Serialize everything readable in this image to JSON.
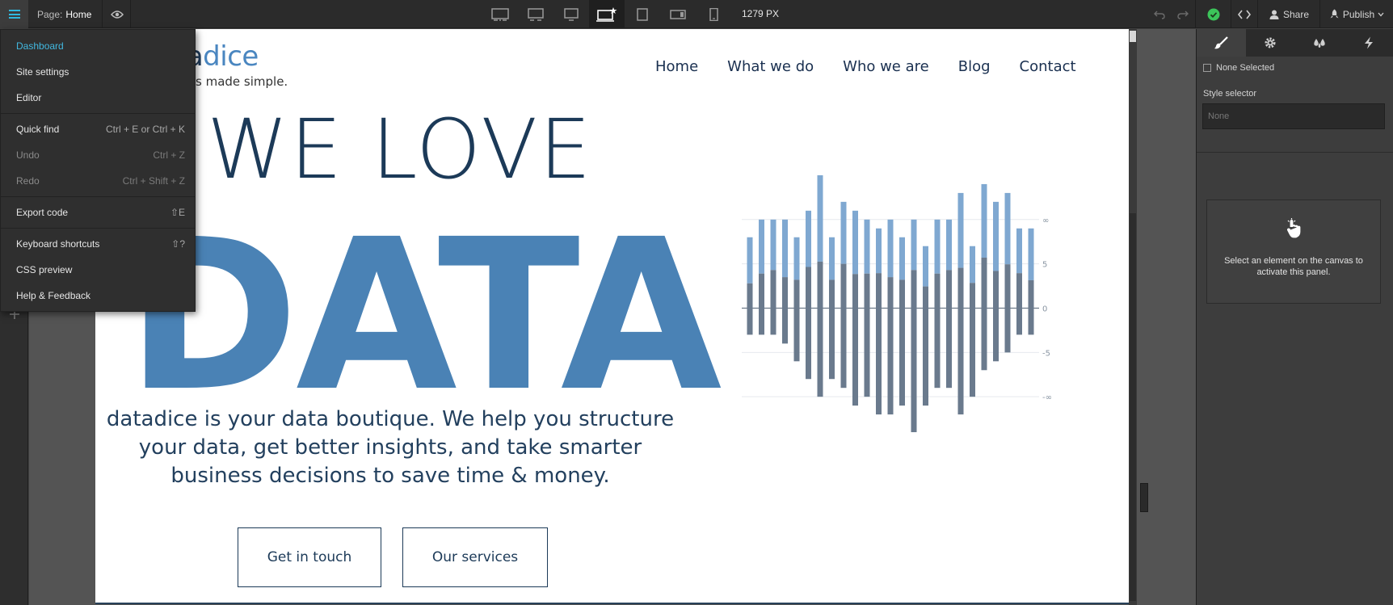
{
  "topbar": {
    "page_label": "Page:",
    "page_name": "Home",
    "width_readout": "1279 PX",
    "share_label": "Share",
    "publish_label": "Publish"
  },
  "menu": {
    "items": [
      {
        "label": "Dashboard",
        "shortcut": ""
      },
      {
        "label": "Site settings",
        "shortcut": ""
      },
      {
        "label": "Editor",
        "shortcut": ""
      },
      {
        "label": "Quick find",
        "shortcut": "Ctrl + E or Ctrl + K"
      },
      {
        "label": "Undo",
        "shortcut": "Ctrl + Z"
      },
      {
        "label": "Redo",
        "shortcut": "Ctrl + Shift + Z"
      },
      {
        "label": "Export code",
        "shortcut": "⇧E"
      },
      {
        "label": "Keyboard shortcuts",
        "shortcut": "⇧?"
      },
      {
        "label": "CSS preview",
        "shortcut": ""
      },
      {
        "label": "Help & Feedback",
        "shortcut": ""
      }
    ]
  },
  "site": {
    "logo_visible": "tadice",
    "logo_tagline_visible": "s made simple.",
    "nav": [
      "Home",
      "What we do",
      "Who we are",
      "Blog",
      "Contact"
    ],
    "hero_line1": "WE LOVE",
    "hero_line2": "DATA",
    "hero_paragraph": "datadice is your data boutique. We help you structure your data, get better insights, and take smarter business decisions to save time & money.",
    "cta_primary": "Get in touch",
    "cta_secondary": "Our services"
  },
  "panel": {
    "none_selected": "None Selected",
    "style_selector_label": "Style selector",
    "style_selector_placeholder": "None",
    "empty_message": "Select an element on the canvas to activate this panel."
  },
  "colors": {
    "accent": "#42b8e0",
    "brand_dark": "#1c3a58",
    "brand_blue": "#4a82b5",
    "success": "#3cc45a"
  },
  "chart_data": {
    "type": "bar",
    "y_tick_labels": [
      "∞",
      "5",
      "0",
      "-5",
      "-∞"
    ],
    "series": [
      {
        "values": [
          8,
          10,
          10,
          10,
          8,
          11,
          15,
          8,
          12,
          11,
          10,
          9,
          10,
          8,
          10,
          7,
          10,
          10,
          13,
          7,
          14,
          12,
          13,
          9,
          9
        ]
      },
      {
        "values": [
          -3,
          -3,
          -3,
          -4,
          -6,
          -8,
          -10,
          -8,
          -9,
          -11,
          -10,
          -12,
          -12,
          -11,
          -14,
          -11,
          -9,
          -9,
          -12,
          -10,
          -7,
          -6,
          -5,
          -3,
          -3
        ]
      }
    ],
    "ylim": [
      -15,
      16
    ],
    "grid": true
  }
}
